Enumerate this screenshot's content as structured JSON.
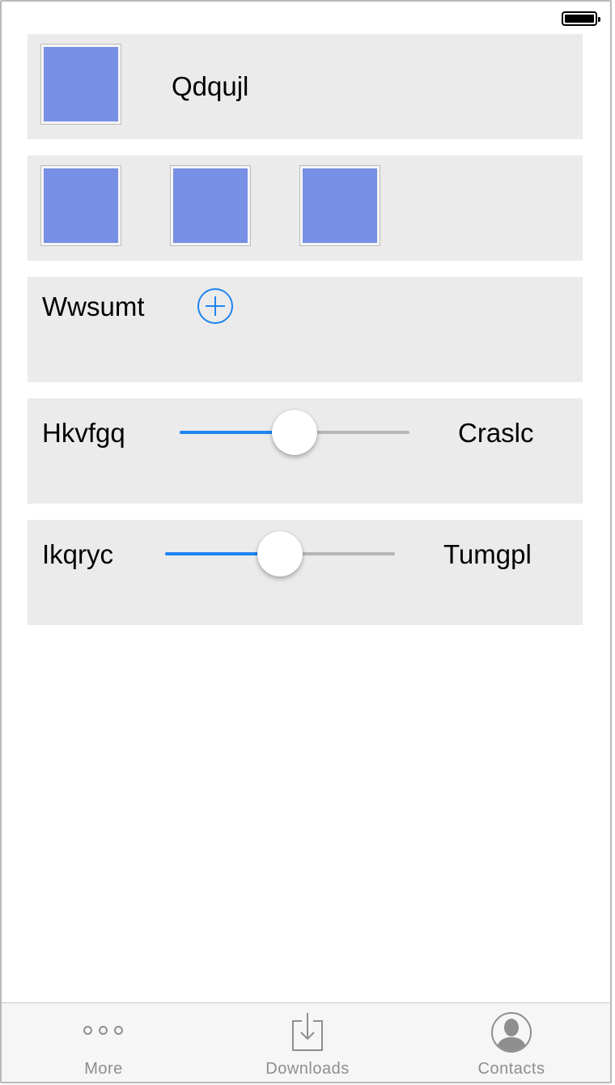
{
  "rows": {
    "row1": {
      "label": "Qdqujl"
    },
    "row3": {
      "label": "Wwsumt"
    },
    "row4": {
      "left_label": "Hkvfgq",
      "right_label": "Craslc",
      "slider_value_fraction": 0.5
    },
    "row5": {
      "left_label": "Ikqryc",
      "right_label": "Tumgpl",
      "slider_value_fraction": 0.5
    }
  },
  "tabbar": {
    "tabs": [
      {
        "label": "More",
        "icon": "more-icon"
      },
      {
        "label": "Downloads",
        "icon": "downloads-icon"
      },
      {
        "label": "Contacts",
        "icon": "contacts-icon"
      }
    ]
  },
  "colors": {
    "accent": "#1f84f0",
    "tile": "#778fe4",
    "row_background": "#ebebeb",
    "tab_inactive": "#8e8e8e"
  }
}
